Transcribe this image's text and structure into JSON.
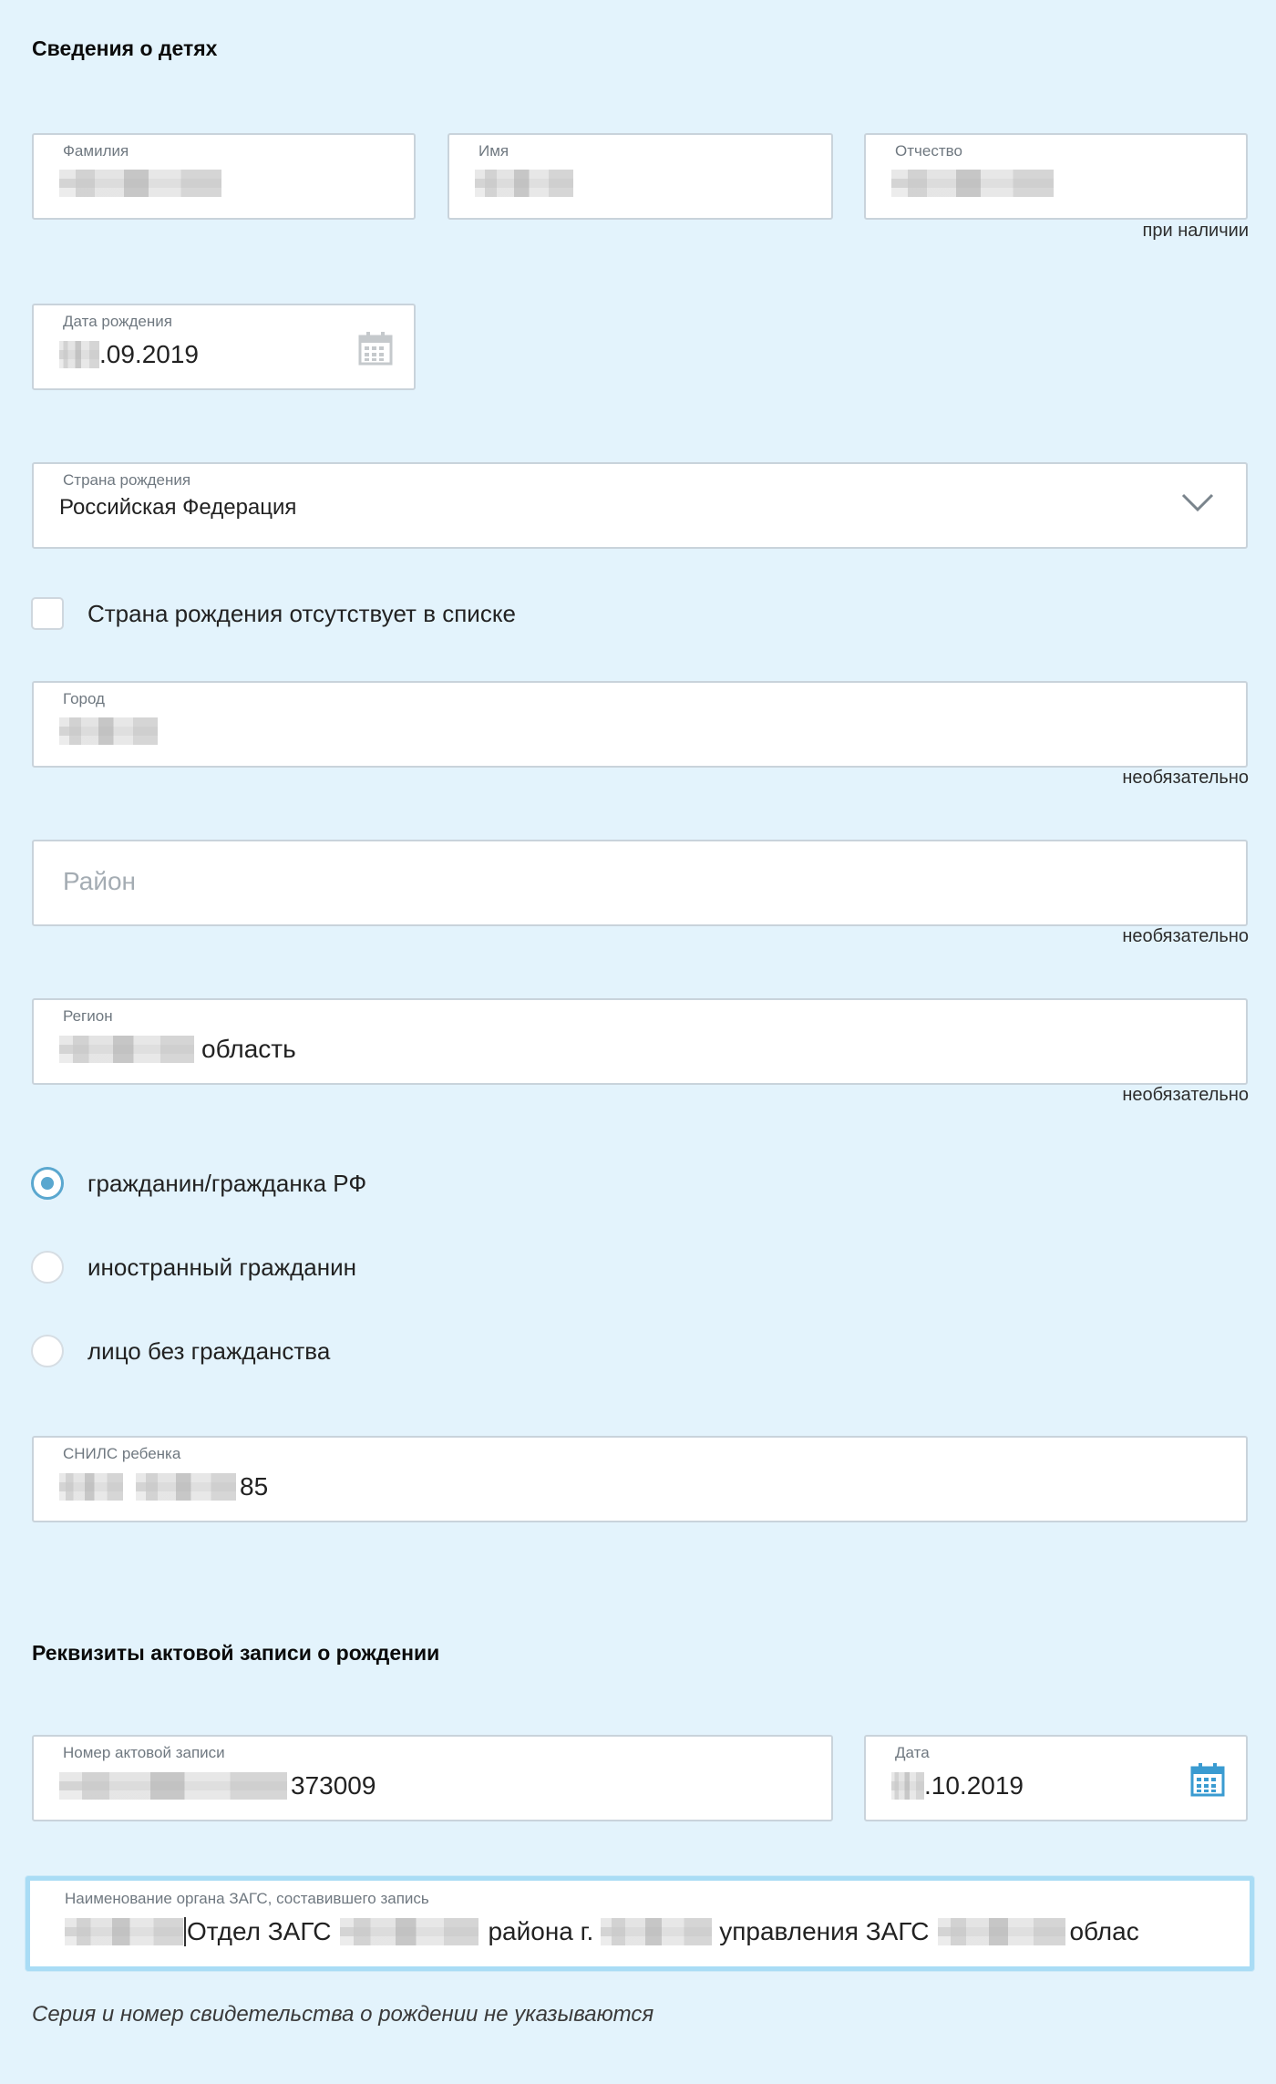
{
  "children_section": {
    "title": "Сведения о детях",
    "surname": {
      "label": "Фамилия"
    },
    "name": {
      "label": "Имя"
    },
    "patronymic": {
      "label": "Отчество",
      "hint": "при наличии"
    },
    "birth_date": {
      "label": "Дата рождения",
      "value_suffix": ".09.2019"
    },
    "birth_country": {
      "label": "Страна рождения",
      "value": "Российская Федерация"
    },
    "country_missing_checkbox": {
      "label": "Страна рождения отсутствует в списке",
      "checked": false
    },
    "city": {
      "label": "Город",
      "hint": "необязательно"
    },
    "district": {
      "placeholder": "Район",
      "hint": "необязательно"
    },
    "region": {
      "label": "Регион",
      "value_suffix": "область",
      "hint": "необязательно"
    },
    "citizenship": {
      "options": [
        {
          "label": "гражданин/гражданка РФ",
          "selected": true
        },
        {
          "label": "иностранный гражданин",
          "selected": false
        },
        {
          "label": "лицо без гражданства",
          "selected": false
        }
      ]
    },
    "snils": {
      "label": "СНИЛС ребенка",
      "value_suffix": "85"
    }
  },
  "record_section": {
    "title": "Реквизиты актовой записи о рождении",
    "record_number": {
      "label": "Номер актовой записи",
      "value_suffix": "373009"
    },
    "record_date": {
      "label": "Дата",
      "value_suffix": ".10.2019"
    },
    "registry_office": {
      "label": "Наименование органа ЗАГС, составившего запись",
      "part1": "Отдел ЗАГС",
      "part2": "района г.",
      "part3": "управления ЗАГС",
      "part4": "облас"
    },
    "note": "Серия и номер свидетельства о рождении не указываются"
  },
  "colors": {
    "background": "#e3f3fc",
    "accent": "#5aa7cf",
    "calendar_active": "#3a9bd1",
    "calendar_inactive": "#c5c9cc"
  }
}
